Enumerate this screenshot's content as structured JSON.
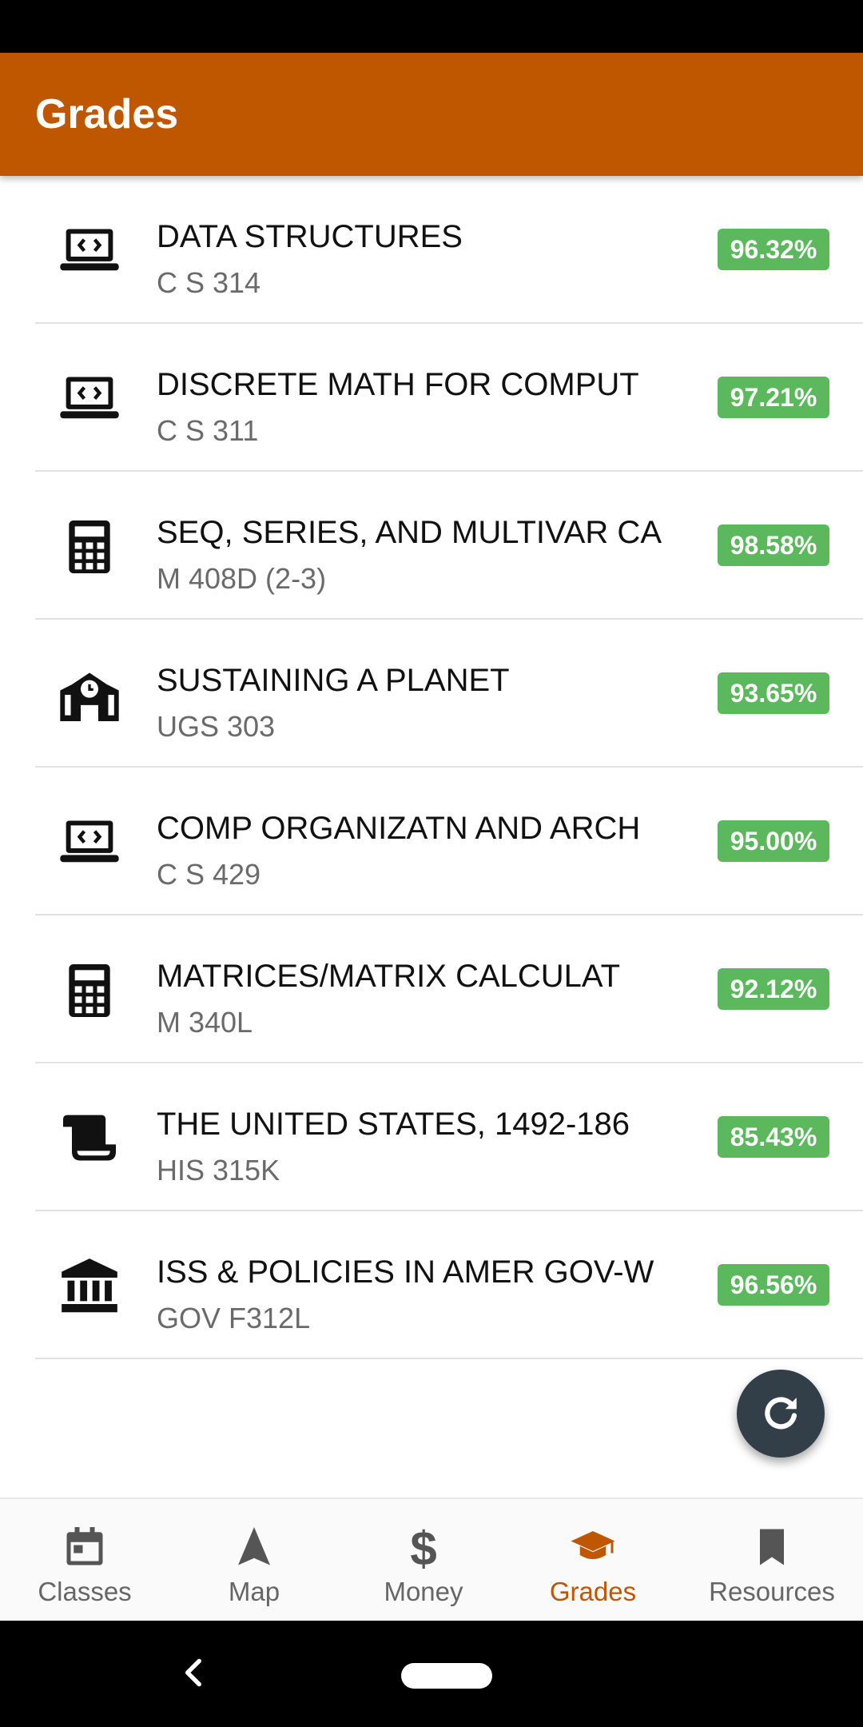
{
  "app_bar": {
    "title": "Grades"
  },
  "courses": [
    {
      "icon": "laptop-code-icon",
      "title": "DATA STRUCTURES",
      "code": "C S 314",
      "grade": "96.32%"
    },
    {
      "icon": "laptop-code-icon",
      "title": "DISCRETE MATH FOR COMPUT",
      "code": "C S 311",
      "grade": "97.21%"
    },
    {
      "icon": "calculator-icon",
      "title": "SEQ, SERIES, AND MULTIVAR CA",
      "code": "M 408D (2-3)",
      "grade": "98.58%"
    },
    {
      "icon": "school-building-icon",
      "title": "SUSTAINING A PLANET",
      "code": "UGS 303",
      "grade": "93.65%"
    },
    {
      "icon": "laptop-code-icon",
      "title": "COMP ORGANIZATN AND ARCH",
      "code": "C S 429",
      "grade": "95.00%"
    },
    {
      "icon": "calculator-icon",
      "title": "MATRICES/MATRIX CALCULAT",
      "code": "M 340L",
      "grade": "92.12%"
    },
    {
      "icon": "scroll-icon",
      "title": "THE UNITED STATES, 1492-186",
      "code": "HIS 315K",
      "grade": "85.43%"
    },
    {
      "icon": "government-building-icon",
      "title": "ISS & POLICIES IN AMER GOV-W",
      "code": "GOV F312L",
      "grade": "96.56%"
    }
  ],
  "fab": {
    "icon": "refresh-icon"
  },
  "bottom_nav": [
    {
      "icon": "calendar-icon",
      "label": "Classes",
      "active": false
    },
    {
      "icon": "navigation-arrow-icon",
      "label": "Map",
      "active": false
    },
    {
      "icon": "dollar-icon",
      "label": "Money",
      "active": false
    },
    {
      "icon": "graduation-cap-icon",
      "label": "Grades",
      "active": true
    },
    {
      "icon": "bookmark-icon",
      "label": "Resources",
      "active": false
    }
  ],
  "colors": {
    "brand": "#bf5700",
    "grade_badge": "#5cb85c",
    "fab": "#333f48",
    "nav_inactive": "#666666"
  }
}
